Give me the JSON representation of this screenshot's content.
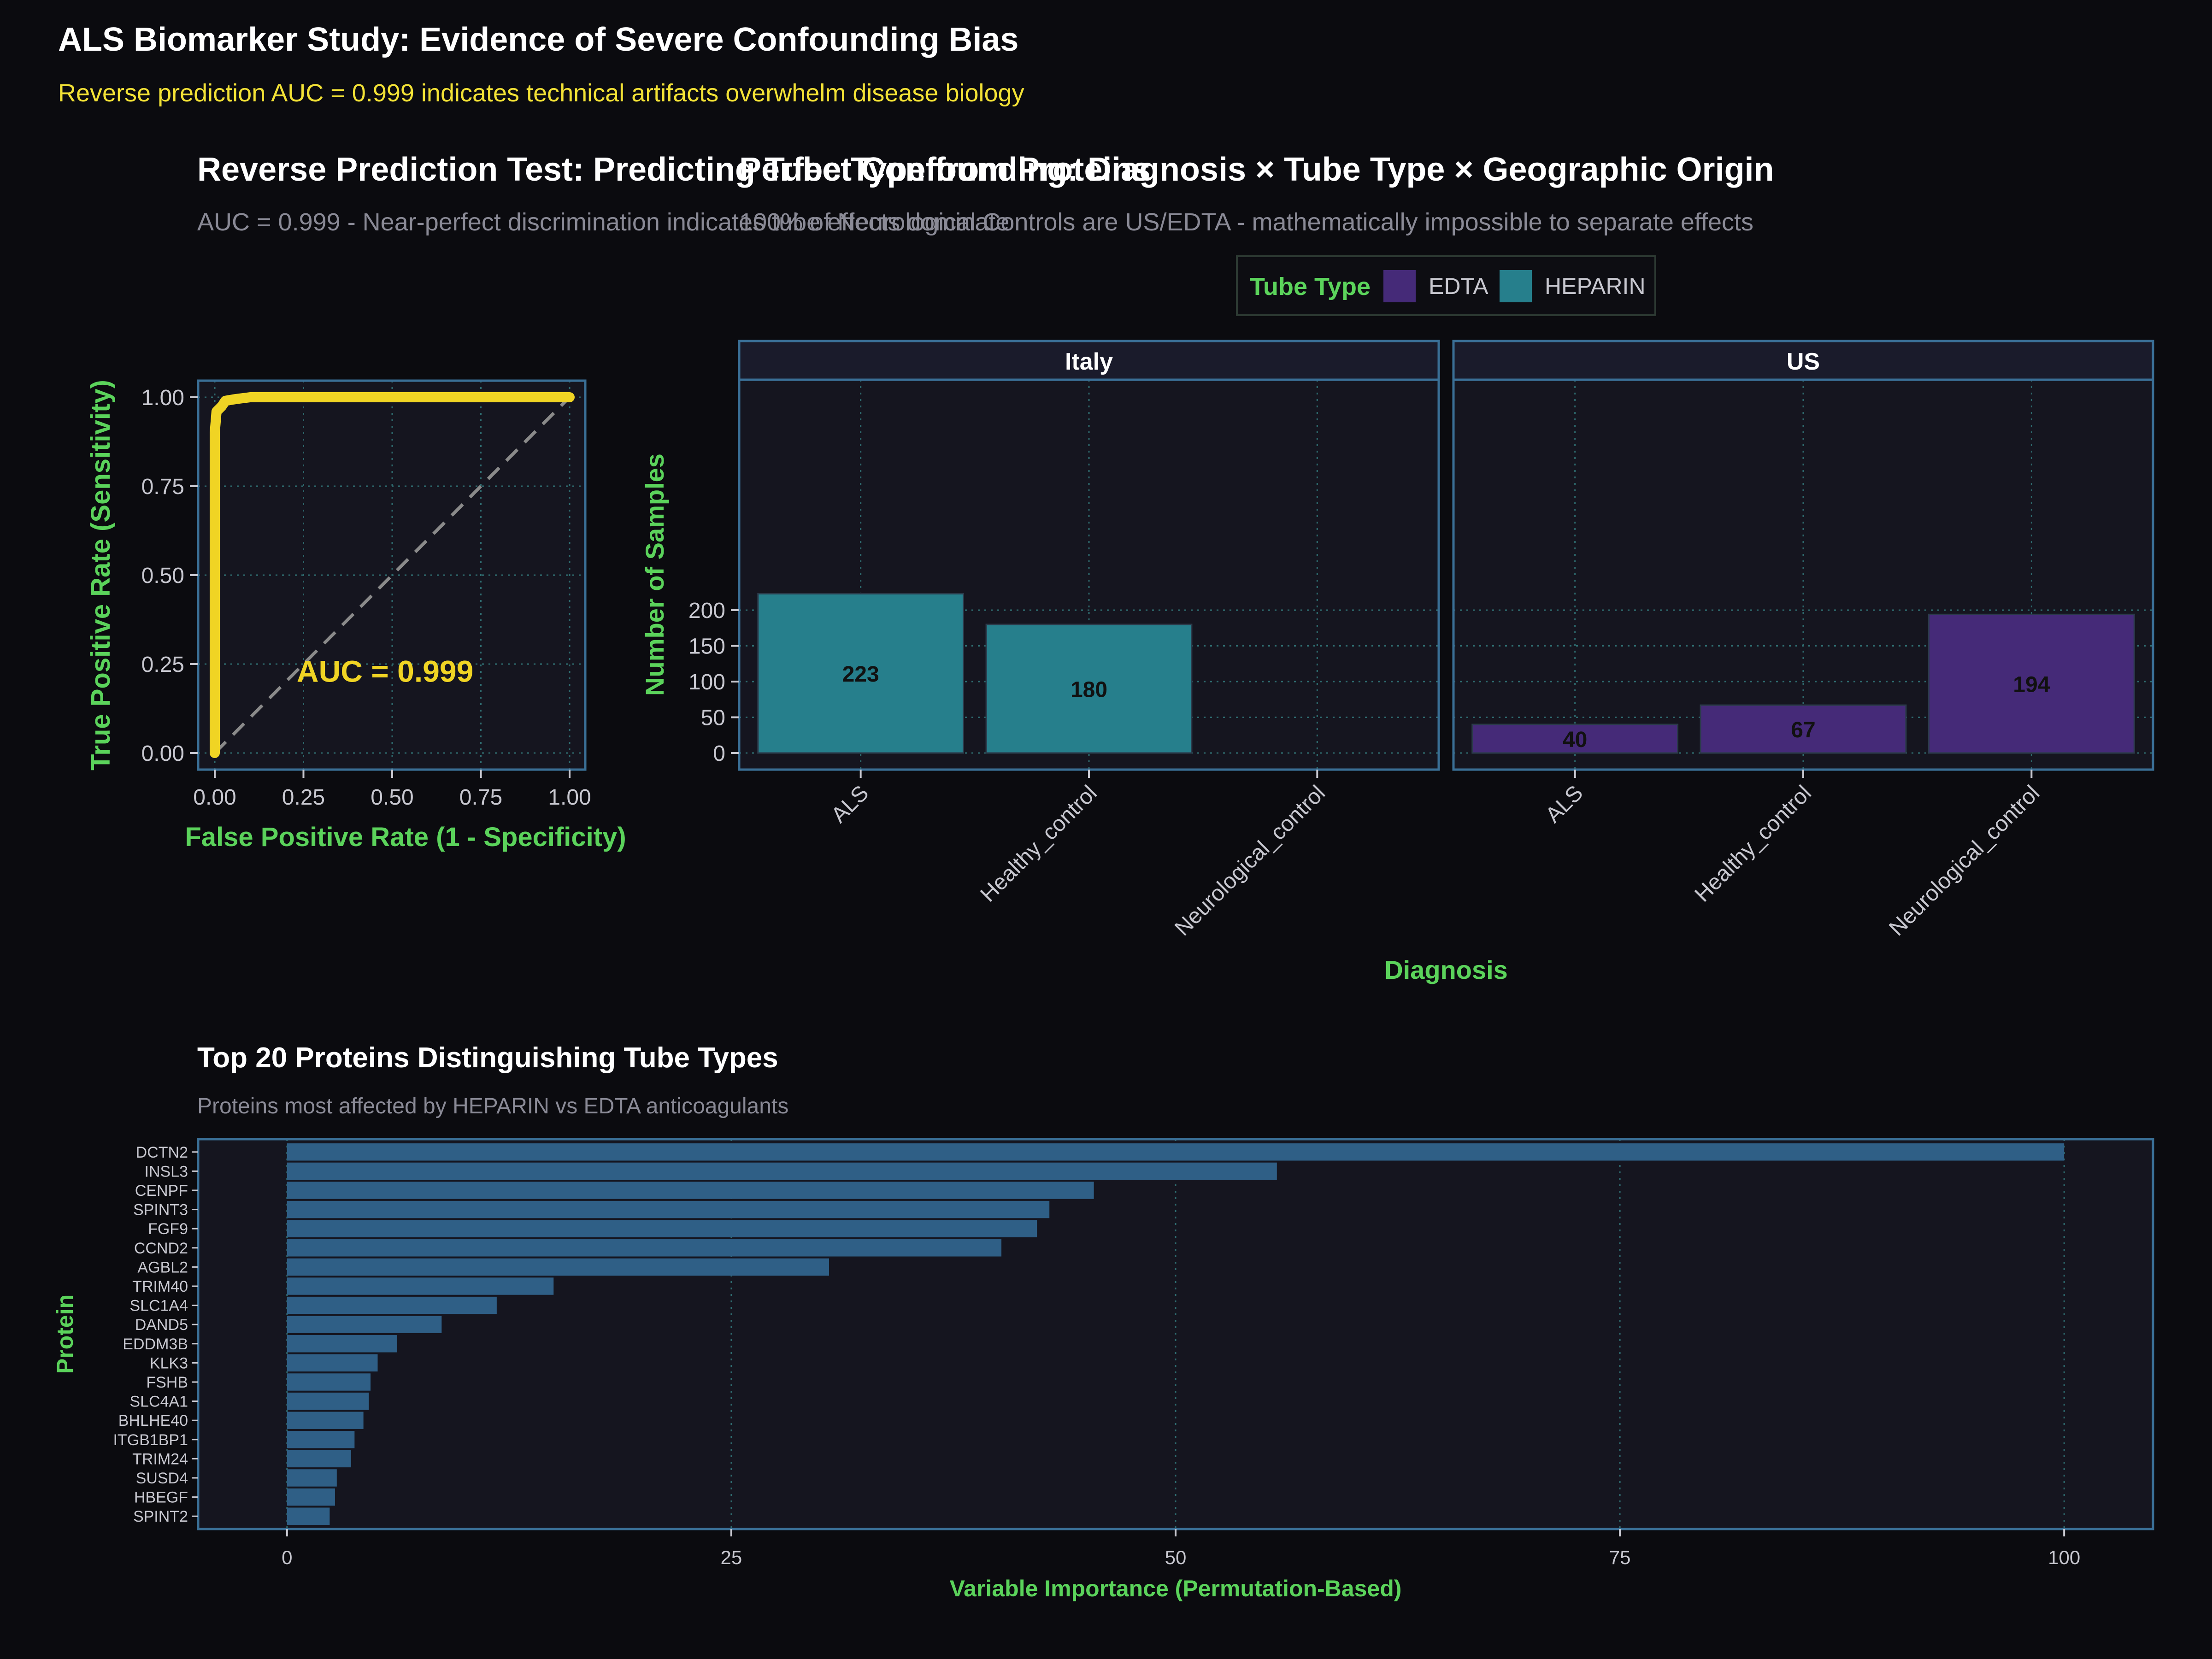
{
  "header": {
    "title": "ALS Biomarker Study: Evidence of Severe Confounding Bias",
    "subtitle": "Reverse prediction AUC = 0.999 indicates technical artifacts overwhelm disease biology"
  },
  "colors": {
    "background": "#0b0b0f",
    "panel": "#15151f",
    "frame": "#3a6f96",
    "grid": "#2e6a6e",
    "title": "#ffffff",
    "subtitle_yellow": "#f3e236",
    "muted": "#8a8a96",
    "axis_label": "#5bd35b",
    "tick": "#c8c8d0",
    "roc_line": "#f0d424",
    "diagonal": "#8a8a8a",
    "edta": "#452a78",
    "heparin": "#267f8c",
    "importance_bar": "#2f5f86",
    "strip_bg": "#1a1b2b",
    "bar_label": "#111111"
  },
  "chart_data": [
    {
      "id": "roc",
      "type": "line",
      "title": "Reverse Prediction Test: Predicting Tube Type from Proteins",
      "subtitle": "AUC = 0.999 - Near-perfect discrimination indicates tube effects dominate",
      "xlabel": "False Positive Rate (1 - Specificity)",
      "ylabel": "True Positive Rate (Sensitivity)",
      "xlim": [
        0,
        1
      ],
      "ylim": [
        0,
        1
      ],
      "xticks": [
        "0.00",
        "0.25",
        "0.50",
        "0.75",
        "1.00"
      ],
      "yticks": [
        "0.00",
        "0.25",
        "0.50",
        "0.75",
        "1.00"
      ],
      "annotation": "AUC = 0.999",
      "annotation_at": [
        0.48,
        0.2
      ],
      "grid": true,
      "curve": [
        [
          0.0,
          0.0
        ],
        [
          0.0,
          0.9
        ],
        [
          0.005,
          0.96
        ],
        [
          0.02,
          0.975
        ],
        [
          0.03,
          0.99
        ],
        [
          0.06,
          0.995
        ],
        [
          0.1,
          1.0
        ],
        [
          1.0,
          1.0
        ]
      ],
      "diagonal": [
        [
          0,
          0
        ],
        [
          1,
          1
        ]
      ]
    },
    {
      "id": "confounding",
      "type": "bar",
      "title": "Perfect Confounding: Diagnosis × Tube Type × Geographic Origin",
      "subtitle": "100% of Neurological Controls are US/EDTA - mathematically impossible to separate effects",
      "xlabel": "Diagnosis",
      "ylabel": "Number of Samples",
      "ylim": [
        0,
        240
      ],
      "yticks": [
        0,
        50,
        100,
        150,
        200
      ],
      "grid": true,
      "legend": {
        "title": "Tube Type",
        "position": "top",
        "entries": [
          "EDTA",
          "HEPARIN"
        ]
      },
      "categories": [
        "ALS",
        "Healthy_control",
        "Neurological_control"
      ],
      "facets": [
        {
          "name": "Italy",
          "values": [
            223,
            180,
            null
          ],
          "tube": [
            "HEPARIN",
            "HEPARIN",
            null
          ]
        },
        {
          "name": "US",
          "values": [
            40,
            67,
            194
          ],
          "tube": [
            "EDTA",
            "EDTA",
            "EDTA"
          ]
        }
      ]
    },
    {
      "id": "importance",
      "type": "bar",
      "orientation": "horizontal",
      "title": "Top 20 Proteins Distinguishing Tube Types",
      "subtitle": "Proteins most affected by HEPARIN vs EDTA anticoagulants",
      "xlabel": "Variable Importance (Permutation-Based)",
      "ylabel": "Protein",
      "xlim": [
        -5,
        105
      ],
      "xticks": [
        0,
        25,
        50,
        75,
        100
      ],
      "grid": true,
      "categories": [
        "DCTN2",
        "INSL3",
        "CENPF",
        "SPINT3",
        "FGF9",
        "CCND2",
        "AGBL2",
        "TRIM40",
        "SLC1A4",
        "DAND5",
        "EDDM3B",
        "KLK3",
        "FSHB",
        "SLC4A1",
        "BHLHE40",
        "ITGB1BP1",
        "TRIM24",
        "SUSD4",
        "HBEGF",
        "SPINT2"
      ],
      "values": [
        100,
        55.7,
        45.4,
        42.9,
        42.2,
        40.2,
        30.5,
        15.0,
        11.8,
        8.7,
        6.2,
        5.1,
        4.7,
        4.6,
        4.3,
        3.8,
        3.6,
        2.8,
        2.7,
        2.4
      ]
    }
  ]
}
